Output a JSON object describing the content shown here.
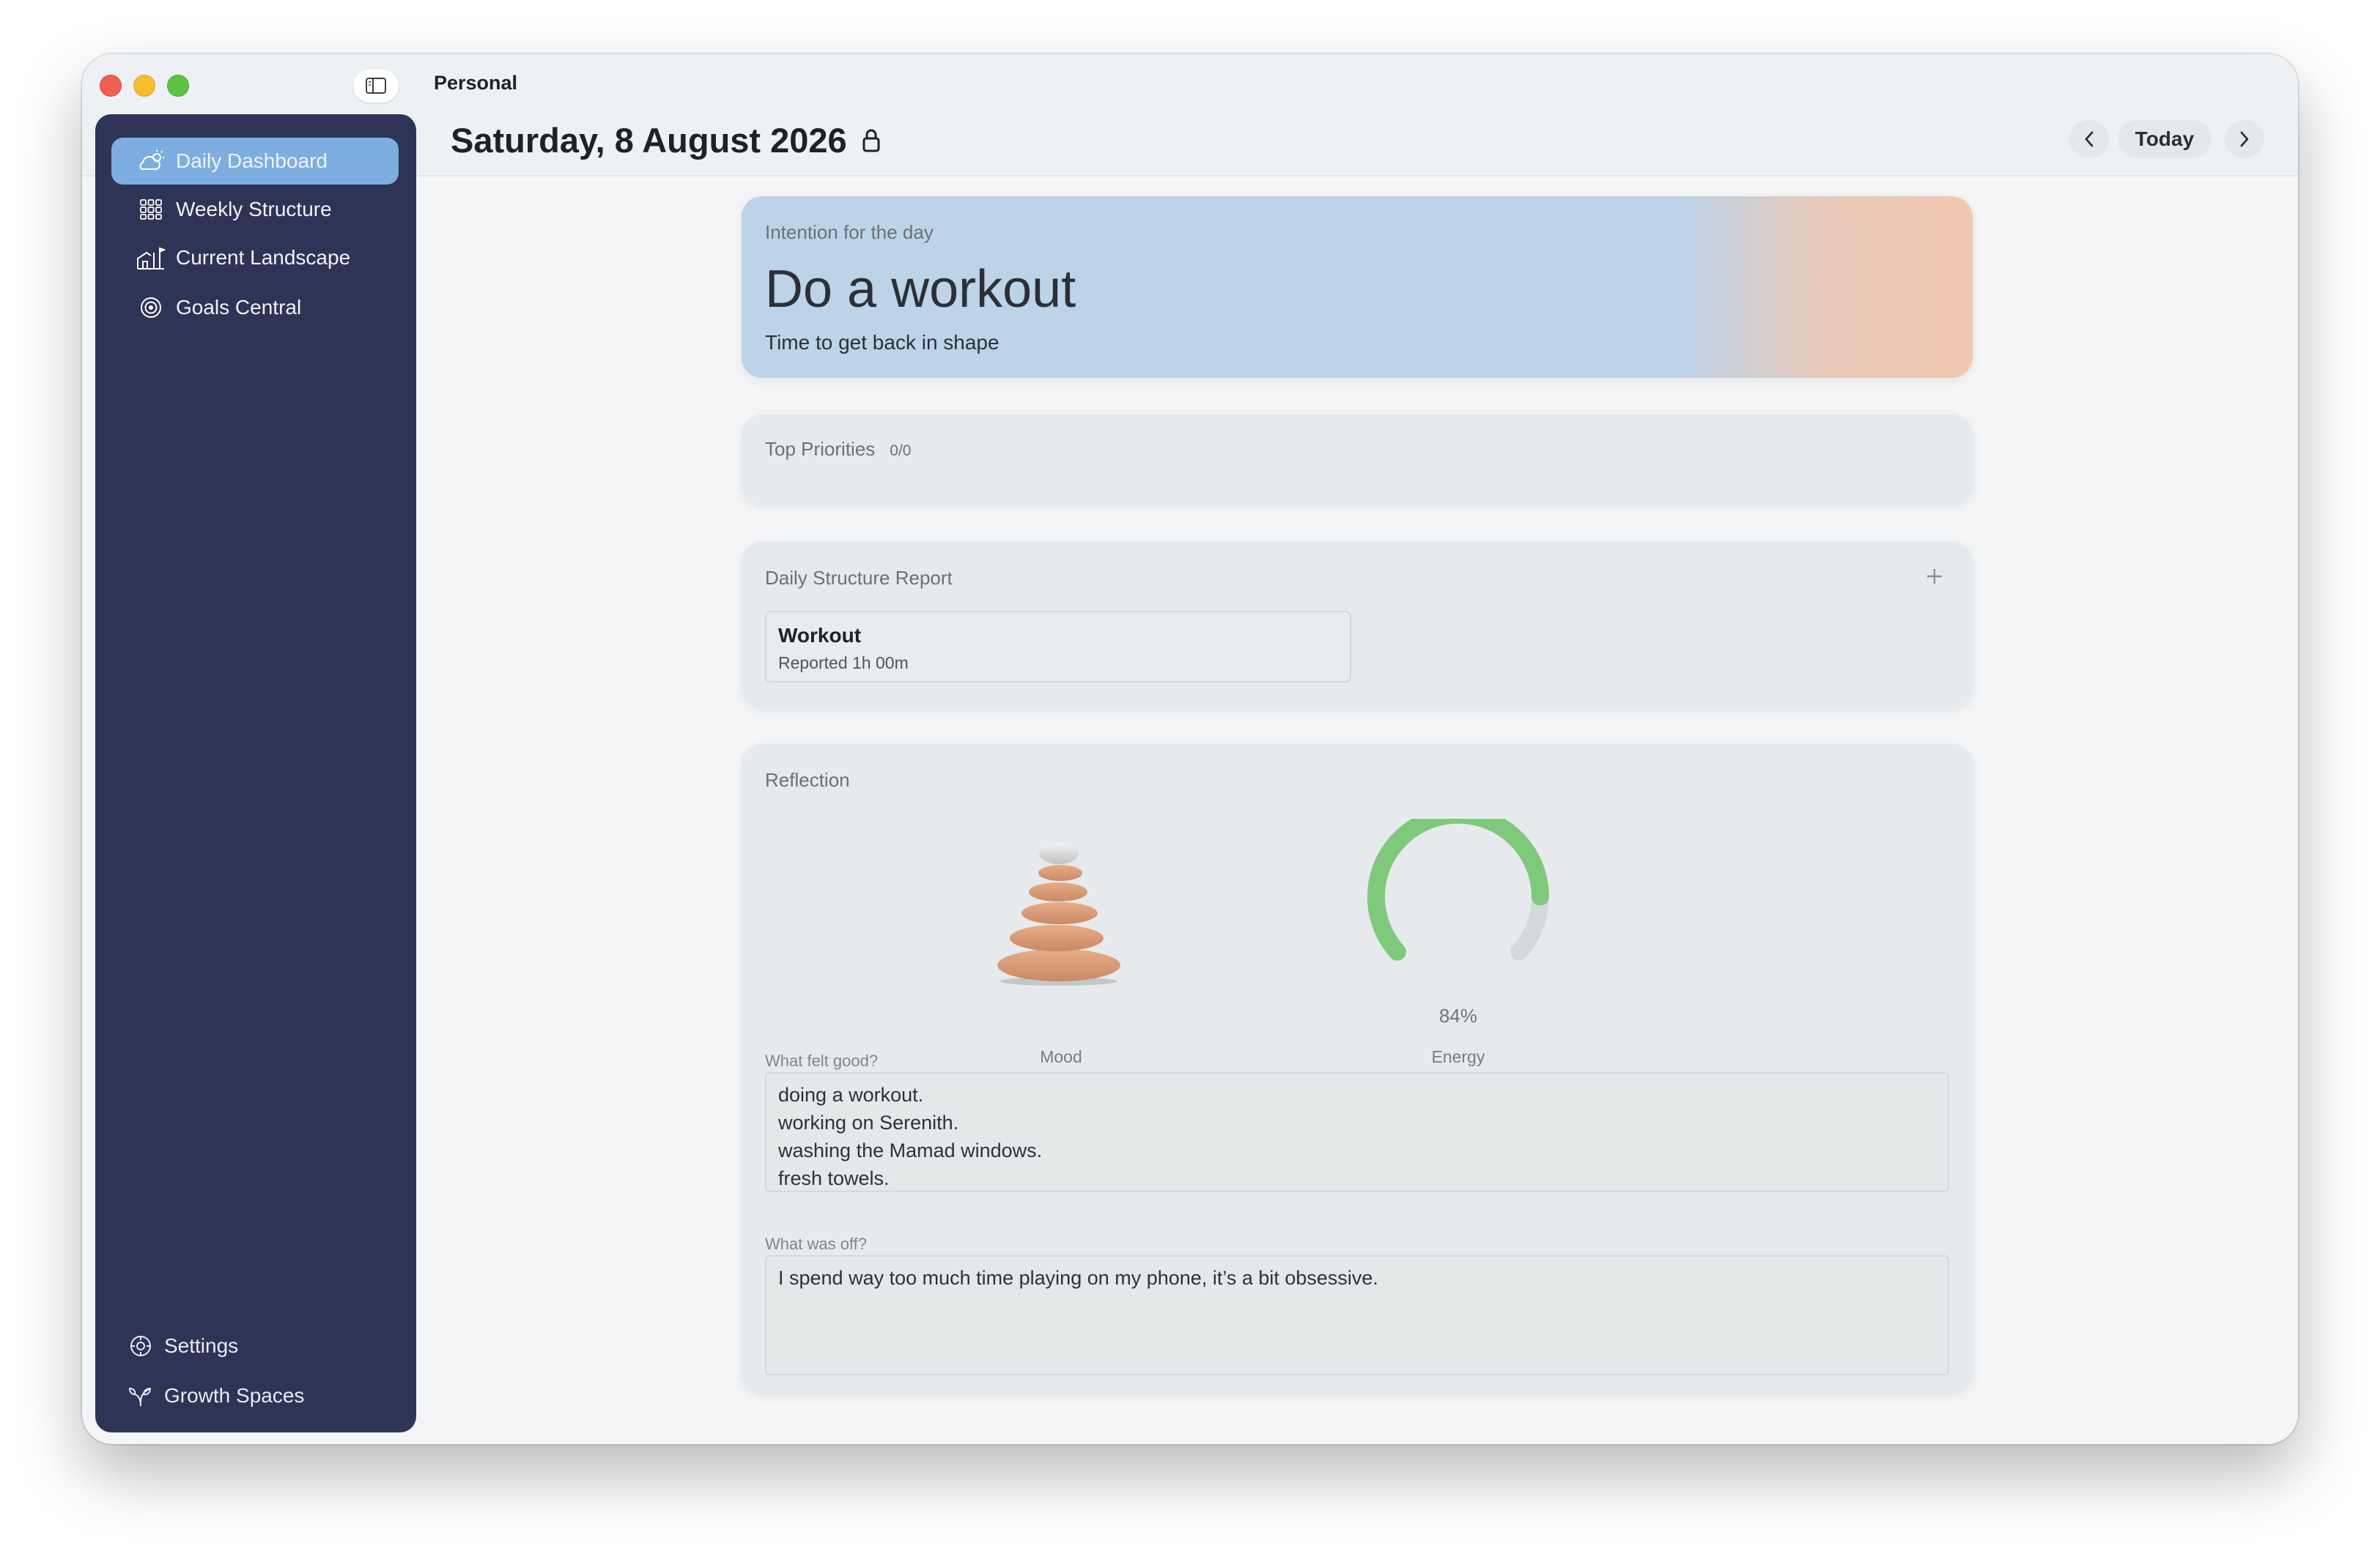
{
  "window": {
    "title": "Personal"
  },
  "header": {
    "date": "Saturday, 8 August 2026",
    "today_label": "Today",
    "lock_icon": "lock-icon",
    "prev_icon": "chevron-left-icon",
    "next_icon": "chevron-right-icon"
  },
  "sidebar": {
    "items": [
      {
        "label": "Daily Dashboard",
        "icon": "sun-cloud-icon",
        "active": true
      },
      {
        "label": "Weekly Structure",
        "icon": "grid-icon",
        "active": false
      },
      {
        "label": "Current Landscape",
        "icon": "landscape-flag-icon",
        "active": false
      },
      {
        "label": "Goals Central",
        "icon": "target-icon",
        "active": false
      }
    ],
    "bottom_items": [
      {
        "label": "Settings",
        "icon": "gear-icon"
      },
      {
        "label": "Growth Spaces",
        "icon": "sprout-icon"
      }
    ]
  },
  "intention": {
    "label": "Intention for the day",
    "title": "Do a workout",
    "subtitle": "Time to get back in shape"
  },
  "priorities": {
    "label": "Top Priorities",
    "count": "0/0"
  },
  "report": {
    "label": "Daily Structure Report",
    "add_icon": "plus-icon",
    "items": [
      {
        "name": "Workout",
        "meta": "Reported 1h 00m"
      }
    ]
  },
  "reflection": {
    "label": "Reflection",
    "mood_label": "Mood",
    "energy_label": "Energy",
    "energy_percent_text": "84%",
    "energy_value": 0.84,
    "q1_label": "What felt good?",
    "q1_lines": [
      "doing a workout.",
      "working on Serenith.",
      "washing the Mamad windows.",
      "fresh towels."
    ],
    "q2_label": "What was off?",
    "q2_text": "I spend way too much time playing on my phone, it’s a bit obsessive."
  },
  "colors": {
    "sidebar_bg": "#2e3455",
    "active_item": "#7eaee0",
    "energy_green": "#7fc97d",
    "energy_track": "#d6d9db"
  }
}
